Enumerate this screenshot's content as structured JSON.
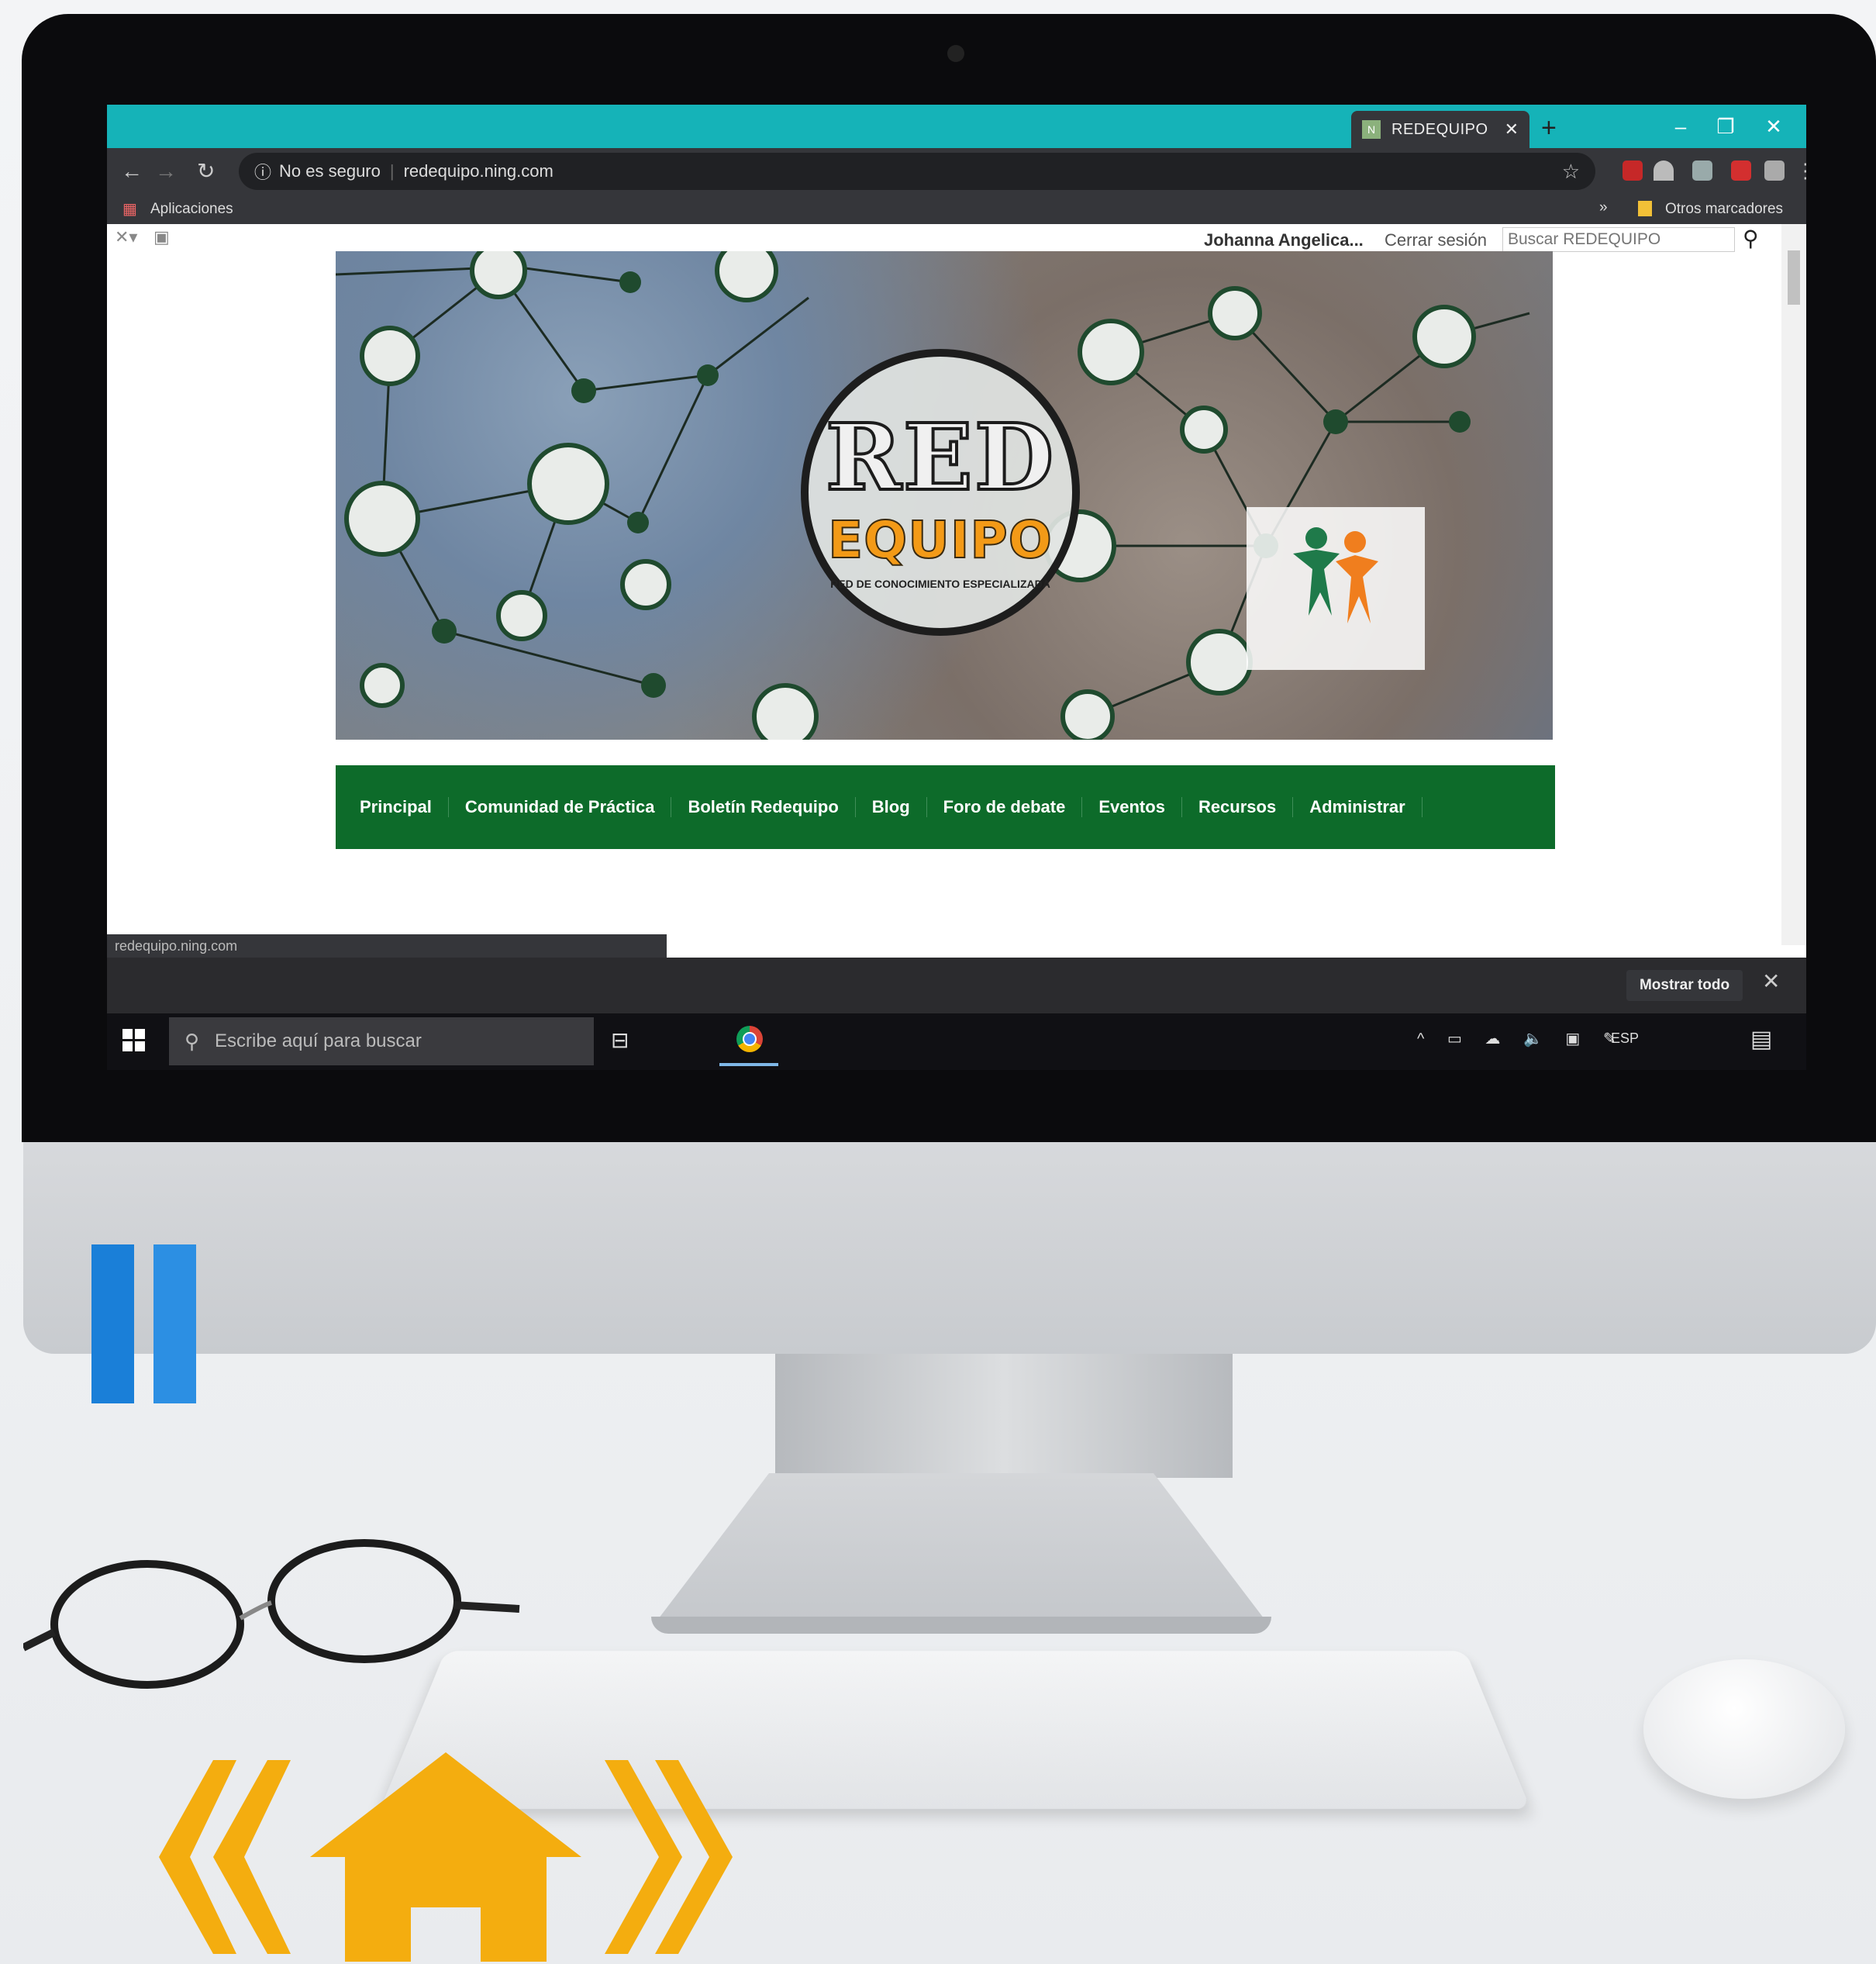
{
  "browser": {
    "tab_title": "REDEQUIPO",
    "tab_favicon": "N",
    "security_label": "No es seguro",
    "url": "redequipo.ning.com",
    "bookmarks_apps": "Aplicaciones",
    "bookmarks_more": "»",
    "bookmarks_other": "Otros marcadores"
  },
  "ning": {
    "user_name": "Johanna Angelica...",
    "logout": "Cerrar sesión",
    "search_placeholder": "Buscar REDEQUIPO"
  },
  "banner": {
    "logo_top": "RED",
    "logo_bottom": "EQUIPO",
    "logo_subtitle": "RED DE CONOCIMIENTO ESPECIALIZADA"
  },
  "menu": {
    "items": [
      "Principal",
      "Comunidad de Práctica",
      "Boletín Redequipo",
      "Blog",
      "Foro de debate",
      "Eventos",
      "Recursos",
      "Administrar"
    ]
  },
  "status": {
    "hover_url": "redequipo.ning.com"
  },
  "downloads": {
    "show_all": "Mostrar todo"
  },
  "taskbar": {
    "search_placeholder": "Escribe aquí para buscar",
    "language": "ESP"
  },
  "colors": {
    "tabstrip": "#15b3b8",
    "menu_green": "#0d6b2a",
    "accent_blue": "#1a7fd8",
    "nav_orange": "#f4ad0f"
  },
  "icons": {
    "back": "arrow-left",
    "forward": "arrow-right",
    "reload": "reload",
    "bookmark_star": "star",
    "search": "magnifier",
    "home": "house",
    "prev": "double-chevron-left",
    "next": "double-chevron-right"
  }
}
